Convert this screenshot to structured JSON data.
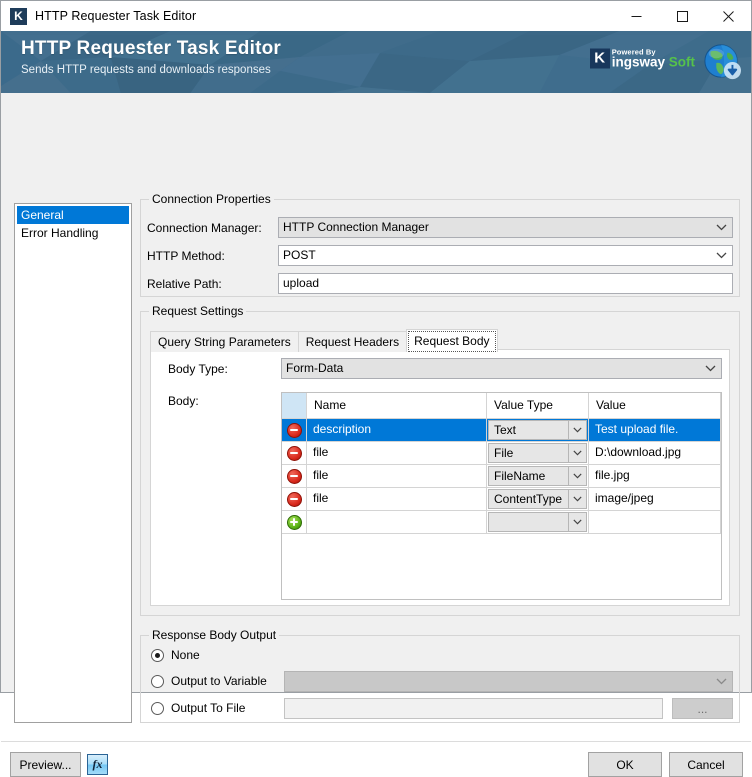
{
  "window": {
    "title": "HTTP Requester Task Editor",
    "app_icon_letter": "K",
    "controls": {
      "minimize": "minimize-icon",
      "maximize": "maximize-icon",
      "close": "close-icon"
    }
  },
  "banner": {
    "title": "HTTP Requester Task Editor",
    "subtitle": "Sends HTTP requests and downloads responses",
    "logo": {
      "mark": "K",
      "powered_by": "Powered By",
      "name_part1": "ingsway",
      "name_part2": "Soft"
    },
    "bg_color": "#3e6d8e"
  },
  "sidebar": {
    "items": [
      {
        "label": "General",
        "selected": true
      },
      {
        "label": "Error Handling",
        "selected": false
      }
    ]
  },
  "connection_properties": {
    "legend": "Connection Properties",
    "connection_manager": {
      "label": "Connection Manager:",
      "value": "HTTP Connection Manager"
    },
    "http_method": {
      "label": "HTTP Method:",
      "value": "POST"
    },
    "relative_path": {
      "label": "Relative Path:",
      "value": "upload"
    }
  },
  "request_settings": {
    "legend": "Request Settings",
    "tabs": [
      {
        "label": "Query String Parameters",
        "active": false
      },
      {
        "label": "Request Headers",
        "active": false
      },
      {
        "label": "Request Body",
        "active": true
      }
    ],
    "body_type": {
      "label": "Body Type:",
      "value": "Form-Data"
    },
    "body": {
      "label": "Body:",
      "columns": [
        "",
        "Name",
        "Value Type",
        "Value"
      ],
      "rows": [
        {
          "action": "remove",
          "name": "description",
          "value_type": "Text",
          "value": "Test upload file.",
          "selected": true
        },
        {
          "action": "remove",
          "name": "file",
          "value_type": "File",
          "value": "D:\\download.jpg",
          "selected": false
        },
        {
          "action": "remove",
          "name": "file",
          "value_type": "FileName",
          "value": "file.jpg",
          "selected": false
        },
        {
          "action": "remove",
          "name": "file",
          "value_type": "ContentType",
          "value": "image/jpeg",
          "selected": false
        },
        {
          "action": "add",
          "name": "",
          "value_type": "",
          "value": "",
          "selected": false
        }
      ]
    }
  },
  "response_body_output": {
    "legend": "Response Body Output",
    "options": [
      {
        "label": "None",
        "selected": true
      },
      {
        "label": "Output to Variable",
        "selected": false
      },
      {
        "label": "Output To File",
        "selected": false
      }
    ],
    "variable_value": "",
    "file_value": "",
    "browse_label": "..."
  },
  "footer": {
    "preview_label": "Preview...",
    "expression_label": "fx",
    "ok_label": "OK",
    "cancel_label": "Cancel"
  },
  "colors": {
    "accent": "#0078d7",
    "banner": "#3e6d8e",
    "window_bg": "#f0f0f0",
    "remove_icon": "#d9291c",
    "add_icon": "#5ab216"
  }
}
